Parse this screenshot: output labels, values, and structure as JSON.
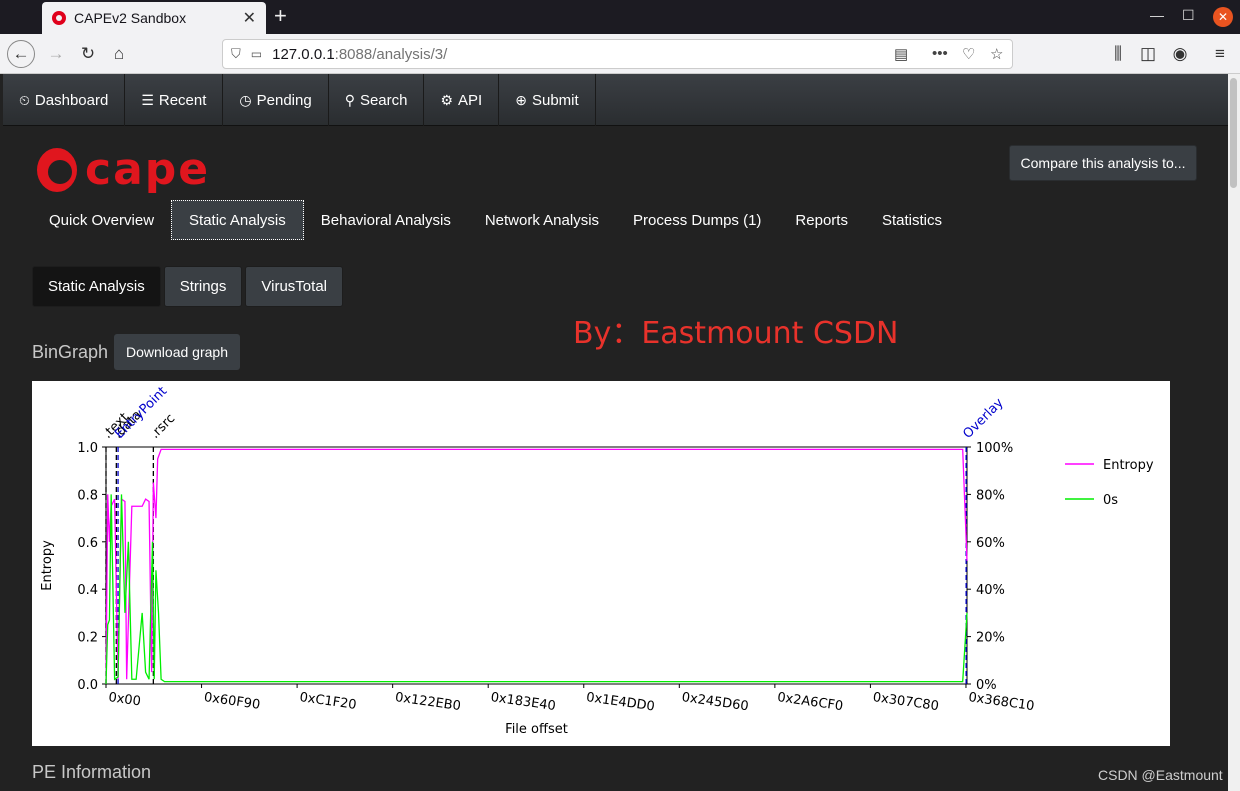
{
  "browser": {
    "tab_title": "CAPEv2 Sandbox",
    "url_host": "127.0.0.1",
    "url_rest": ":8088/analysis/3/"
  },
  "nav": [
    {
      "label": "Dashboard",
      "icon": "⏲"
    },
    {
      "label": "Recent",
      "icon": "☰"
    },
    {
      "label": "Pending",
      "icon": "◷"
    },
    {
      "label": "Search",
      "icon": "⚲"
    },
    {
      "label": "API",
      "icon": "⚙"
    },
    {
      "label": "Submit",
      "icon": "⊕"
    }
  ],
  "logo_text": "cape",
  "compare_button": "Compare this analysis to...",
  "tabs": [
    "Quick Overview",
    "Static Analysis",
    "Behavioral Analysis",
    "Network Analysis",
    "Process Dumps (1)",
    "Reports",
    "Statistics"
  ],
  "subtabs": [
    "Static Analysis",
    "Strings",
    "VirusTotal"
  ],
  "watermark": "By：Eastmount CSDN",
  "bingraph_title": "BinGraph",
  "download_button": "Download graph",
  "pe_title": "PE Information",
  "csdn_mark": "CSDN @Eastmount",
  "chart_data": {
    "type": "line",
    "xlabel": "File offset",
    "ylabel": "Entropy",
    "x_ticks": [
      "0x00",
      "0x60F90",
      "0xC1F20",
      "0x122EB0",
      "0x183E40",
      "0x1E4DD0",
      "0x245D60",
      "0x2A6CF0",
      "0x307C80",
      "0x368C10"
    ],
    "y_ticks": [
      "0.0",
      "0.2",
      "0.4",
      "0.6",
      "0.8",
      "1.0"
    ],
    "y2_ticks": [
      "0%",
      "20%",
      "40%",
      "60%",
      "80%",
      "100%"
    ],
    "ylim": [
      0,
      1.0
    ],
    "legend_position": "right",
    "series": [
      {
        "name": "Entropy",
        "color": "#ff00ff",
        "x": [
          0,
          0.002,
          0.004,
          0.006,
          0.01,
          0.014,
          0.018,
          0.022,
          0.024,
          0.03,
          0.035,
          0.042,
          0.046,
          0.05,
          0.053,
          0.055,
          0.058,
          0.06,
          0.064,
          0.07,
          0.2,
          0.5,
          0.8,
          0.995,
          1.0
        ],
        "y": [
          0.0,
          0.8,
          0.6,
          0.75,
          0.78,
          0.02,
          0.78,
          0.77,
          0.02,
          0.75,
          0.75,
          0.75,
          0.78,
          0.77,
          0.05,
          0.85,
          0.7,
          0.95,
          0.99,
          0.99,
          0.99,
          0.99,
          0.99,
          0.99,
          0.52
        ]
      },
      {
        "name": "0s",
        "color": "#00ee00",
        "x": [
          0,
          0.002,
          0.004,
          0.006,
          0.01,
          0.014,
          0.018,
          0.022,
          0.026,
          0.03,
          0.035,
          0.042,
          0.046,
          0.05,
          0.054,
          0.056,
          0.058,
          0.061,
          0.064,
          0.068,
          0.2,
          0.5,
          0.8,
          0.995,
          1.0
        ],
        "y": [
          0.0,
          0.25,
          0.27,
          0.8,
          0.02,
          0.03,
          0.8,
          0.3,
          0.6,
          0.02,
          0.02,
          0.3,
          0.05,
          0.02,
          0.6,
          0.02,
          0.48,
          0.3,
          0.02,
          0.01,
          0.01,
          0.01,
          0.01,
          0.01,
          0.3
        ]
      }
    ],
    "sections": [
      {
        "label": ".text",
        "color": "#000000",
        "x": 0.0
      },
      {
        "label": ".data",
        "color": "#000000",
        "x": 0.012
      },
      {
        "label": "EntryPoint",
        "color": "#0000cc",
        "x": 0.014
      },
      {
        "label": ".rsrc",
        "color": "#000000",
        "x": 0.055
      },
      {
        "label": "Overlay",
        "color": "#0000cc",
        "x": 0.999
      }
    ]
  }
}
